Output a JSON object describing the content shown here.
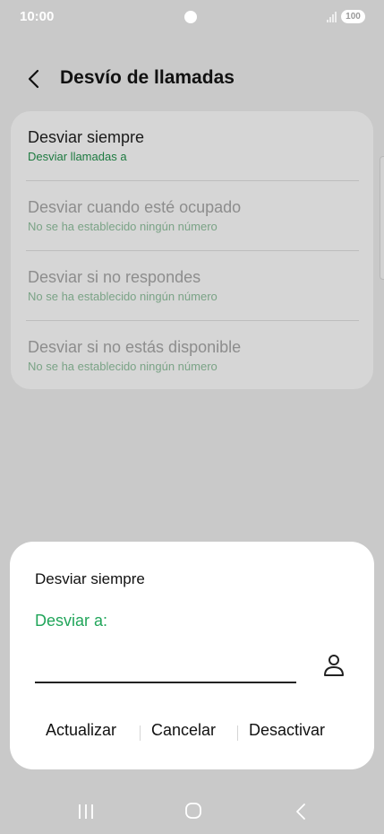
{
  "status_bar": {
    "time": "10:00",
    "battery": "100"
  },
  "header": {
    "title": "Desvío de llamadas"
  },
  "list": {
    "items": [
      {
        "title": "Desviar siempre",
        "subtitle": "Desviar llamadas a"
      },
      {
        "title": "Desviar cuando esté ocupado",
        "subtitle": "No se ha establecido ningún número"
      },
      {
        "title": "Desviar si no respondes",
        "subtitle": "No se ha establecido ningún número"
      },
      {
        "title": "Desviar si no estás disponible",
        "subtitle": "No se ha establecido ningún número"
      }
    ]
  },
  "dialog": {
    "title": "Desviar siempre",
    "field_label": "Desviar a:",
    "field_value": "",
    "actions": {
      "update": "Actualizar",
      "cancel": "Cancelar",
      "deactivate": "Desactivar"
    }
  },
  "colors": {
    "accent": "#21a55a",
    "background": "#c9c9c9",
    "card": "#d6d6d6",
    "dialog": "#ffffff"
  },
  "icons": {
    "back": "chevron-left-icon",
    "contact": "person-icon",
    "signal": "signal-icon"
  }
}
